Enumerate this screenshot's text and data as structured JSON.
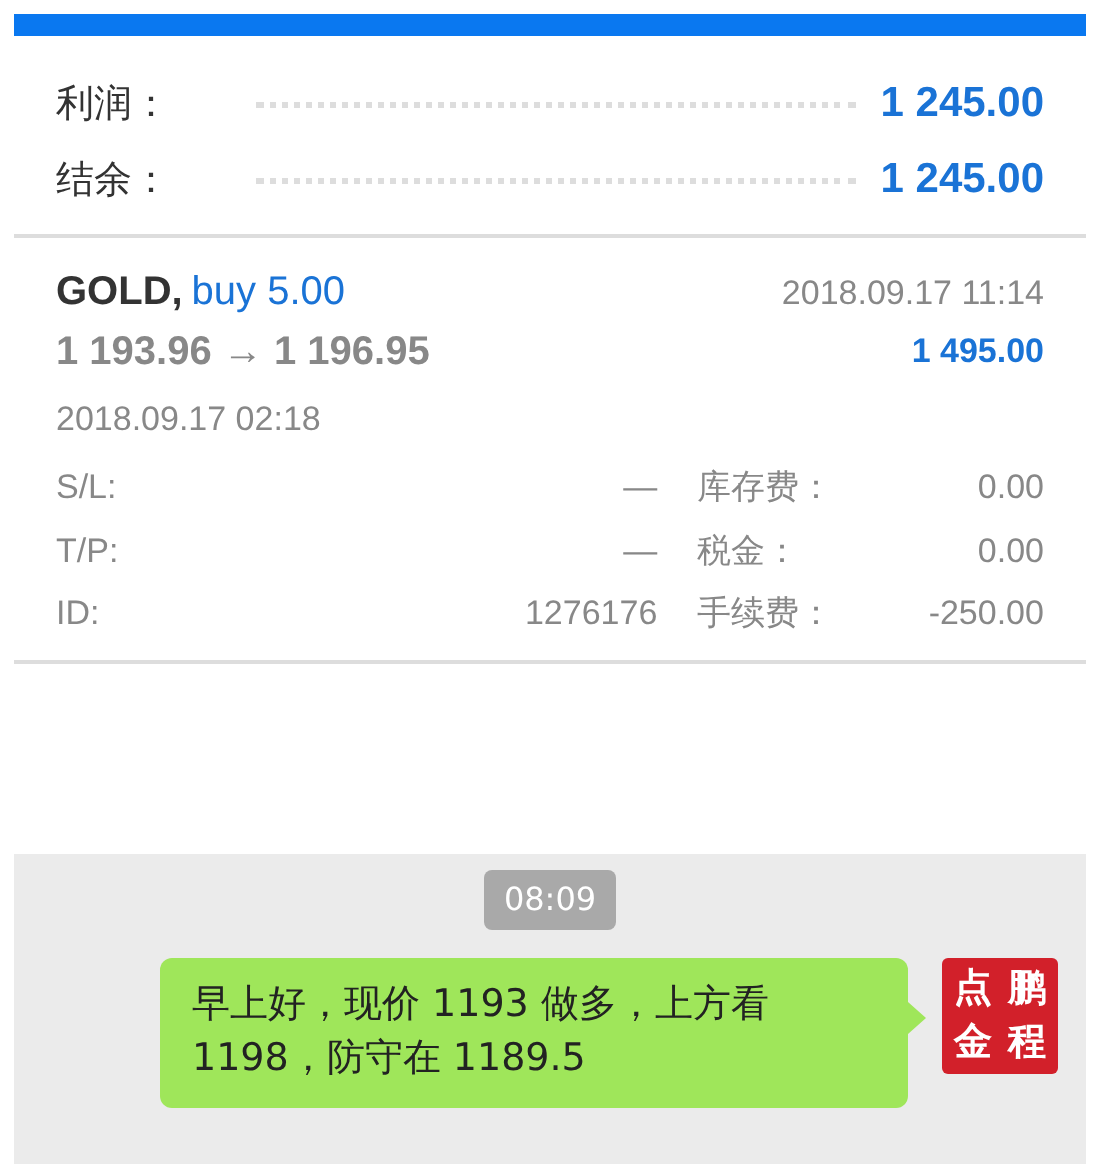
{
  "summary": [
    {
      "label": "利润：",
      "value": "1 245.00"
    },
    {
      "label": "结余：",
      "value": "1 245.00"
    }
  ],
  "trade": {
    "symbol": "GOLD,",
    "side": "buy 5.00",
    "prices": "1 193.96 → 1 196.95",
    "close_time": "2018.09.17 11:14",
    "profit": "1 495.00",
    "open_time": "2018.09.17 02:18",
    "details": [
      {
        "label": "S/L:",
        "value": "—",
        "label_2": "库存费：",
        "value_2": "0.00"
      },
      {
        "label": "T/P:",
        "value": "—",
        "label_2": "税金：",
        "value_2": "0.00"
      },
      {
        "label": "ID:",
        "value": "1276176",
        "label_2": "手续费：",
        "value_2": "-250.00"
      }
    ]
  },
  "chat": {
    "time": "08:09",
    "message": "早上好，现价 1193 做多，上方看 1198，防守在 1189.5",
    "avatar": [
      "点",
      "鹏",
      "金",
      "程"
    ]
  }
}
